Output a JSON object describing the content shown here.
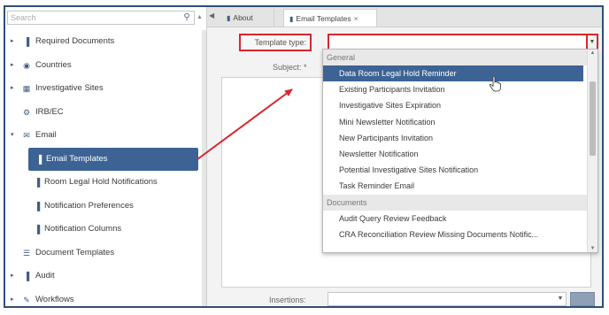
{
  "search": {
    "placeholder": "Search"
  },
  "tree": [
    {
      "label": "Required Documents",
      "icon": "document-icon",
      "level": 0,
      "expander": "▸"
    },
    {
      "label": "Countries",
      "icon": "globe-icon",
      "level": 0,
      "expander": "▸"
    },
    {
      "label": "Investigative Sites",
      "icon": "building-icon",
      "level": 0,
      "expander": "▸"
    },
    {
      "label": "IRB/EC",
      "icon": "gear-icon",
      "level": 0,
      "expander": ""
    },
    {
      "label": "Email",
      "icon": "envelope-icon",
      "level": 0,
      "expander": "▾"
    },
    {
      "label": "Email Templates",
      "icon": "document-icon",
      "level": 1,
      "selected": true
    },
    {
      "label": "Room Legal Hold Notifications",
      "icon": "document-icon",
      "level": 1
    },
    {
      "label": "Notification Preferences",
      "icon": "document-icon",
      "level": 1
    },
    {
      "label": "Notification Columns",
      "icon": "document-icon",
      "level": 1
    },
    {
      "label": "Document Templates",
      "icon": "list-icon",
      "level": 0,
      "expander": ""
    },
    {
      "label": "Audit",
      "icon": "document-icon",
      "level": 0,
      "expander": "▸"
    },
    {
      "label": "Workflows",
      "icon": "pencil-icon",
      "level": 0,
      "expander": "▸"
    }
  ],
  "tabs": {
    "about": "About",
    "email_templates": "Email Templates",
    "close": "×"
  },
  "form": {
    "template_type_label": "Template type:",
    "subject_label": "Subject: *",
    "insertions_label": "Insertions:"
  },
  "dropdown": {
    "groups": [
      {
        "label": "General",
        "options": [
          "Data Room Legal Hold Reminder",
          "Existing Participants Invitation",
          "Investigative Sites Expiration",
          "Mini Newsletter Notification",
          "New Participants Invitation",
          "Newsletter Notification",
          "Potential Investigative Sites Notification",
          "Task Reminder Email"
        ]
      },
      {
        "label": "Documents",
        "options": [
          "Audit Query Review Feedback",
          "CRA Reconciliation Review Missing Documents Notific..."
        ]
      }
    ],
    "highlighted": "Data Room Legal Hold Reminder"
  },
  "colors": {
    "accent": "#3d6394",
    "annotation_red": "#d9262e",
    "frame": "#2e4f77"
  }
}
